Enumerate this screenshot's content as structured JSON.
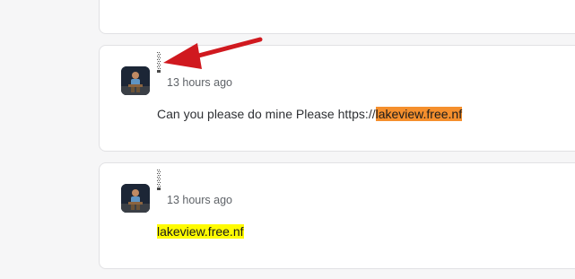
{
  "comments": [
    {
      "time": "13 hours ago",
      "text_prefix": "Can you please do mine Please https://",
      "link_text": "lakeview.free.nf",
      "highlight_color": "#f58f2d"
    },
    {
      "time": "13 hours ago",
      "text_prefix": "",
      "link_text": "lakeview.free.nf",
      "highlight_color": "#fffb00"
    }
  ],
  "annotation": {
    "icon": "red-arrow-icon",
    "color": "#d0191f"
  }
}
